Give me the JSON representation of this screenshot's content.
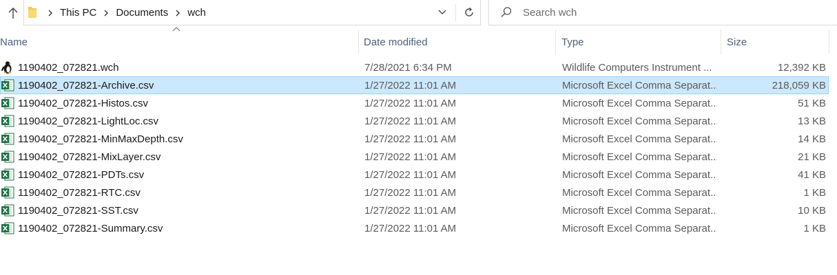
{
  "address": {
    "crumbs": [
      "This PC",
      "Documents",
      "wch"
    ]
  },
  "search": {
    "placeholder": "Search wch"
  },
  "columns": {
    "name": "Name",
    "date": "Date modified",
    "type": "Type",
    "size": "Size"
  },
  "files": [
    {
      "name": "1190402_072821.wch",
      "date": "7/28/2021 6:34 PM",
      "type": "Wildlife Computers Instrument ...",
      "size": "12,392 KB",
      "icon": "wch-file-icon",
      "selected": false
    },
    {
      "name": "1190402_072821-Archive.csv",
      "date": "1/27/2022 11:01 AM",
      "type": "Microsoft Excel Comma Separat...",
      "size": "218,059 KB",
      "icon": "excel-csv-icon",
      "selected": true
    },
    {
      "name": "1190402_072821-Histos.csv",
      "date": "1/27/2022 11:01 AM",
      "type": "Microsoft Excel Comma Separat...",
      "size": "51 KB",
      "icon": "excel-csv-icon",
      "selected": false
    },
    {
      "name": "1190402_072821-LightLoc.csv",
      "date": "1/27/2022 11:01 AM",
      "type": "Microsoft Excel Comma Separat...",
      "size": "13 KB",
      "icon": "excel-csv-icon",
      "selected": false
    },
    {
      "name": "1190402_072821-MinMaxDepth.csv",
      "date": "1/27/2022 11:01 AM",
      "type": "Microsoft Excel Comma Separat...",
      "size": "14 KB",
      "icon": "excel-csv-icon",
      "selected": false
    },
    {
      "name": "1190402_072821-MixLayer.csv",
      "date": "1/27/2022 11:01 AM",
      "type": "Microsoft Excel Comma Separat...",
      "size": "21 KB",
      "icon": "excel-csv-icon",
      "selected": false
    },
    {
      "name": "1190402_072821-PDTs.csv",
      "date": "1/27/2022 11:01 AM",
      "type": "Microsoft Excel Comma Separat...",
      "size": "41 KB",
      "icon": "excel-csv-icon",
      "selected": false
    },
    {
      "name": "1190402_072821-RTC.csv",
      "date": "1/27/2022 11:01 AM",
      "type": "Microsoft Excel Comma Separat...",
      "size": "1 KB",
      "icon": "excel-csv-icon",
      "selected": false
    },
    {
      "name": "1190402_072821-SST.csv",
      "date": "1/27/2022 11:01 AM",
      "type": "Microsoft Excel Comma Separat...",
      "size": "10 KB",
      "icon": "excel-csv-icon",
      "selected": false
    },
    {
      "name": "1190402_072821-Summary.csv",
      "date": "1/27/2022 11:01 AM",
      "type": "Microsoft Excel Comma Separat...",
      "size": "1 KB",
      "icon": "excel-csv-icon",
      "selected": false
    }
  ],
  "colors": {
    "selection_bg": "#cce8ff",
    "selection_border": "#99d1ff",
    "header_text": "#4c607a",
    "excel_green": "#1d7044"
  }
}
